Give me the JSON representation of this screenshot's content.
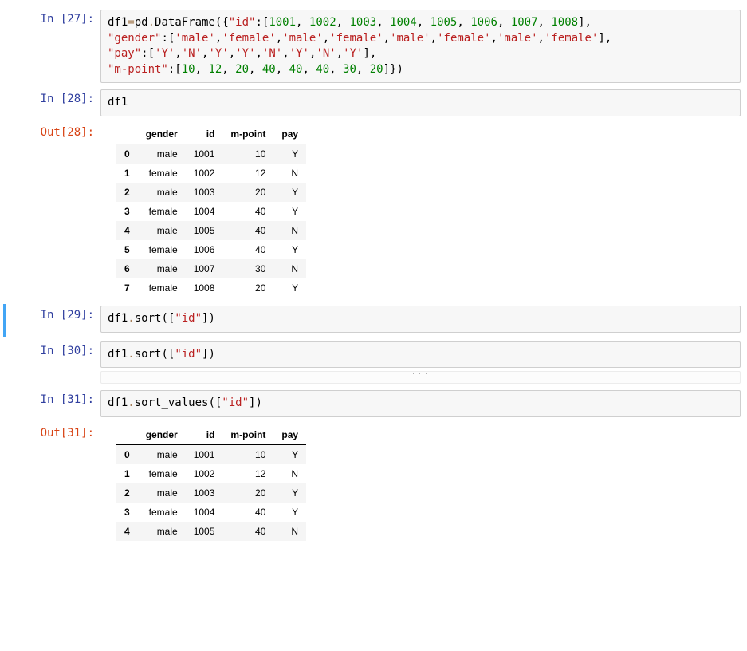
{
  "cells": {
    "c27": {
      "in_label": "In  [27]:",
      "code_html": "<span class='py-name'>df1</span><span class='py-op'>=</span><span class='py-name'>pd</span><span class='py-op'>.</span><span class='py-name'>DataFrame</span><span class='py-punc'>({</span><span class='py-str'>\"id\"</span><span class='py-punc'>:[</span><span class='py-num'>1001</span><span class='py-punc'>, </span><span class='py-num'>1002</span><span class='py-punc'>, </span><span class='py-num'>1003</span><span class='py-punc'>, </span><span class='py-num'>1004</span><span class='py-punc'>, </span><span class='py-num'>1005</span><span class='py-punc'>, </span><span class='py-num'>1006</span><span class='py-punc'>, </span><span class='py-num'>1007</span><span class='py-punc'>, </span><span class='py-num'>1008</span><span class='py-punc'>],</span>\n<span class='py-str'>\"gender\"</span><span class='py-punc'>:[</span><span class='py-str'>'male'</span><span class='py-punc'>,</span><span class='py-str'>'female'</span><span class='py-punc'>,</span><span class='py-str'>'male'</span><span class='py-punc'>,</span><span class='py-str'>'female'</span><span class='py-punc'>,</span><span class='py-str'>'male'</span><span class='py-punc'>,</span><span class='py-str'>'female'</span><span class='py-punc'>,</span><span class='py-str'>'male'</span><span class='py-punc'>,</span><span class='py-str'>'female'</span><span class='py-punc'>],</span>\n<span class='py-str'>\"pay\"</span><span class='py-punc'>:[</span><span class='py-str'>'Y'</span><span class='py-punc'>,</span><span class='py-str'>'N'</span><span class='py-punc'>,</span><span class='py-str'>'Y'</span><span class='py-punc'>,</span><span class='py-str'>'Y'</span><span class='py-punc'>,</span><span class='py-str'>'N'</span><span class='py-punc'>,</span><span class='py-str'>'Y'</span><span class='py-punc'>,</span><span class='py-str'>'N'</span><span class='py-punc'>,</span><span class='py-str'>'Y'</span><span class='py-punc'>],</span>\n<span class='py-str'>\"m-point\"</span><span class='py-punc'>:[</span><span class='py-num'>10</span><span class='py-punc'>, </span><span class='py-num'>12</span><span class='py-punc'>, </span><span class='py-num'>20</span><span class='py-punc'>, </span><span class='py-num'>40</span><span class='py-punc'>, </span><span class='py-num'>40</span><span class='py-punc'>, </span><span class='py-num'>40</span><span class='py-punc'>, </span><span class='py-num'>30</span><span class='py-punc'>, </span><span class='py-num'>20</span><span class='py-punc'>]})</span>"
    },
    "c28": {
      "in_label": "In  [28]:",
      "out_label": "Out[28]:",
      "code_html": "<span class='py-name'>df1</span>",
      "table": {
        "columns": [
          "gender",
          "id",
          "m-point",
          "pay"
        ],
        "rows": [
          {
            "idx": "0",
            "gender": "male",
            "id": "1001",
            "mpoint": "10",
            "pay": "Y"
          },
          {
            "idx": "1",
            "gender": "female",
            "id": "1002",
            "mpoint": "12",
            "pay": "N"
          },
          {
            "idx": "2",
            "gender": "male",
            "id": "1003",
            "mpoint": "20",
            "pay": "Y"
          },
          {
            "idx": "3",
            "gender": "female",
            "id": "1004",
            "mpoint": "40",
            "pay": "Y"
          },
          {
            "idx": "4",
            "gender": "male",
            "id": "1005",
            "mpoint": "40",
            "pay": "N"
          },
          {
            "idx": "5",
            "gender": "female",
            "id": "1006",
            "mpoint": "40",
            "pay": "Y"
          },
          {
            "idx": "6",
            "gender": "male",
            "id": "1007",
            "mpoint": "30",
            "pay": "N"
          },
          {
            "idx": "7",
            "gender": "female",
            "id": "1008",
            "mpoint": "20",
            "pay": "Y"
          }
        ]
      }
    },
    "c29": {
      "in_label": "In  [29]:",
      "code_html": "<span class='py-name'>df1</span><span class='py-op'>.</span><span class='py-name'>sort</span><span class='py-punc'>([</span><span class='py-str'>\"id\"</span><span class='py-punc'>])</span>"
    },
    "c30": {
      "in_label": "In  [30]:",
      "code_html": "<span class='py-name'>df1</span><span class='py-op'>.</span><span class='py-name'>sort</span><span class='py-punc'>([</span><span class='py-str'>\"id\"</span><span class='py-punc'>])</span>"
    },
    "c31": {
      "in_label": "In  [31]:",
      "out_label": "Out[31]:",
      "code_html": "<span class='py-name'>df1</span><span class='py-op'>.</span><span class='py-name'>sort_values</span><span class='py-punc'>([</span><span class='py-str'>\"id\"</span><span class='py-punc'>])</span>",
      "table": {
        "columns": [
          "gender",
          "id",
          "m-point",
          "pay"
        ],
        "rows": [
          {
            "idx": "0",
            "gender": "male",
            "id": "1001",
            "mpoint": "10",
            "pay": "Y"
          },
          {
            "idx": "1",
            "gender": "female",
            "id": "1002",
            "mpoint": "12",
            "pay": "N"
          },
          {
            "idx": "2",
            "gender": "male",
            "id": "1003",
            "mpoint": "20",
            "pay": "Y"
          },
          {
            "idx": "3",
            "gender": "female",
            "id": "1004",
            "mpoint": "40",
            "pay": "Y"
          },
          {
            "idx": "4",
            "gender": "male",
            "id": "1005",
            "mpoint": "40",
            "pay": "N"
          }
        ]
      }
    }
  },
  "ellipsis": ". . ."
}
